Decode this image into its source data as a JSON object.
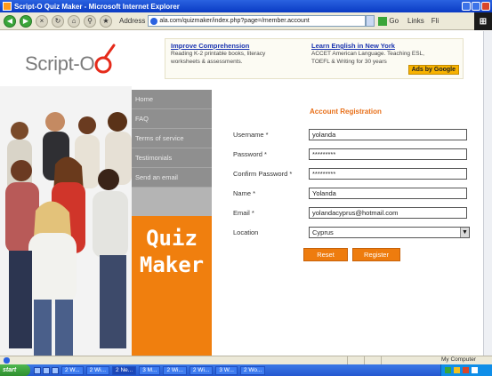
{
  "browser": {
    "title": "Script-O Quiz Maker - Microsoft Internet Explorer",
    "address_label": "Address",
    "address": "ala.com/quizmaker/index.php?page=/member.account",
    "go_label": "Go",
    "links_label": "Links",
    "extra_label": "Fli"
  },
  "site": {
    "logo_text": "Script-O",
    "ads": [
      {
        "title": "Improve Comprehension",
        "body": [
          "Reading K-2 printable books, literacy",
          "worksheets & assessments."
        ]
      },
      {
        "title": "Learn English in New York",
        "body": [
          "ACCET American Language. Teaching ESL,",
          "TOEFL & Writing for 30 years"
        ]
      }
    ],
    "ads_badge": "Ads by Google"
  },
  "nav": {
    "items": [
      {
        "label": "Home"
      },
      {
        "label": "FAQ"
      },
      {
        "label": "Terms of service"
      },
      {
        "label": "Testimonials"
      },
      {
        "label": "Send an email"
      }
    ],
    "product_line1": "Quiz",
    "product_line2": "Maker"
  },
  "form": {
    "heading": "Account Registration",
    "fields": [
      {
        "label": "Username *",
        "value": "yolanda"
      },
      {
        "label": "Password *",
        "value": "*********"
      },
      {
        "label": "Confirm Password *",
        "value": "*********"
      },
      {
        "label": "Name *",
        "value": "Yolanda"
      },
      {
        "label": "Email *",
        "value": "yolandacyprus@hotmail.com"
      }
    ],
    "location_label": "Location",
    "location_value": "Cyprus",
    "reset_label": "Reset",
    "register_label": "Register"
  },
  "status": {
    "zone": "My Computer"
  },
  "taskbar": {
    "start": "start",
    "tasks": [
      "2 W...",
      "2 Wi...",
      "2 Ne...",
      "3 M...",
      "2 Wi...",
      "2 Wi...",
      "3 W...",
      "2 Wo..."
    ]
  },
  "colors": {
    "accent_orange": "#f07f0e",
    "nav_gray": "#8f8f8f",
    "xp_blue": "#2458d0"
  }
}
